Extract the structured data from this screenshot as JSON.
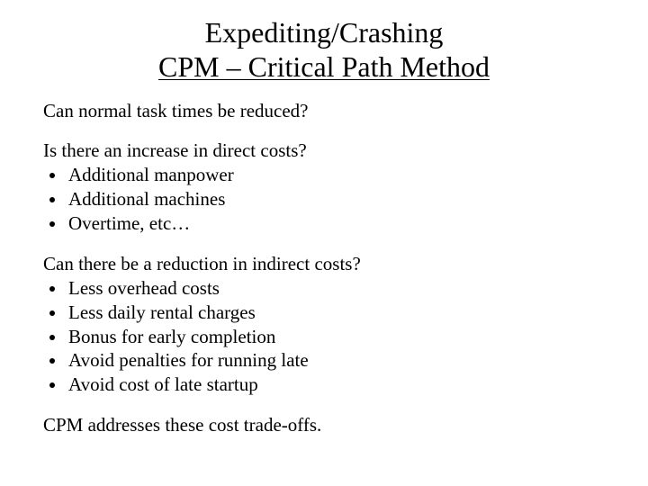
{
  "title": {
    "line1": "Expediting/Crashing",
    "line2": "CPM – Critical Path Method"
  },
  "intro": "Can normal task times be reduced?",
  "direct": {
    "question": "Is there an increase in direct costs?",
    "items": [
      "Additional manpower",
      "Additional machines",
      "Overtime, etc…"
    ]
  },
  "indirect": {
    "question": "Can there be a reduction in indirect costs?",
    "items": [
      "Less overhead costs",
      "Less daily rental charges",
      "Bonus for early completion",
      "Avoid penalties for running late",
      "Avoid cost of late startup"
    ]
  },
  "closing": "CPM addresses these cost trade-offs."
}
